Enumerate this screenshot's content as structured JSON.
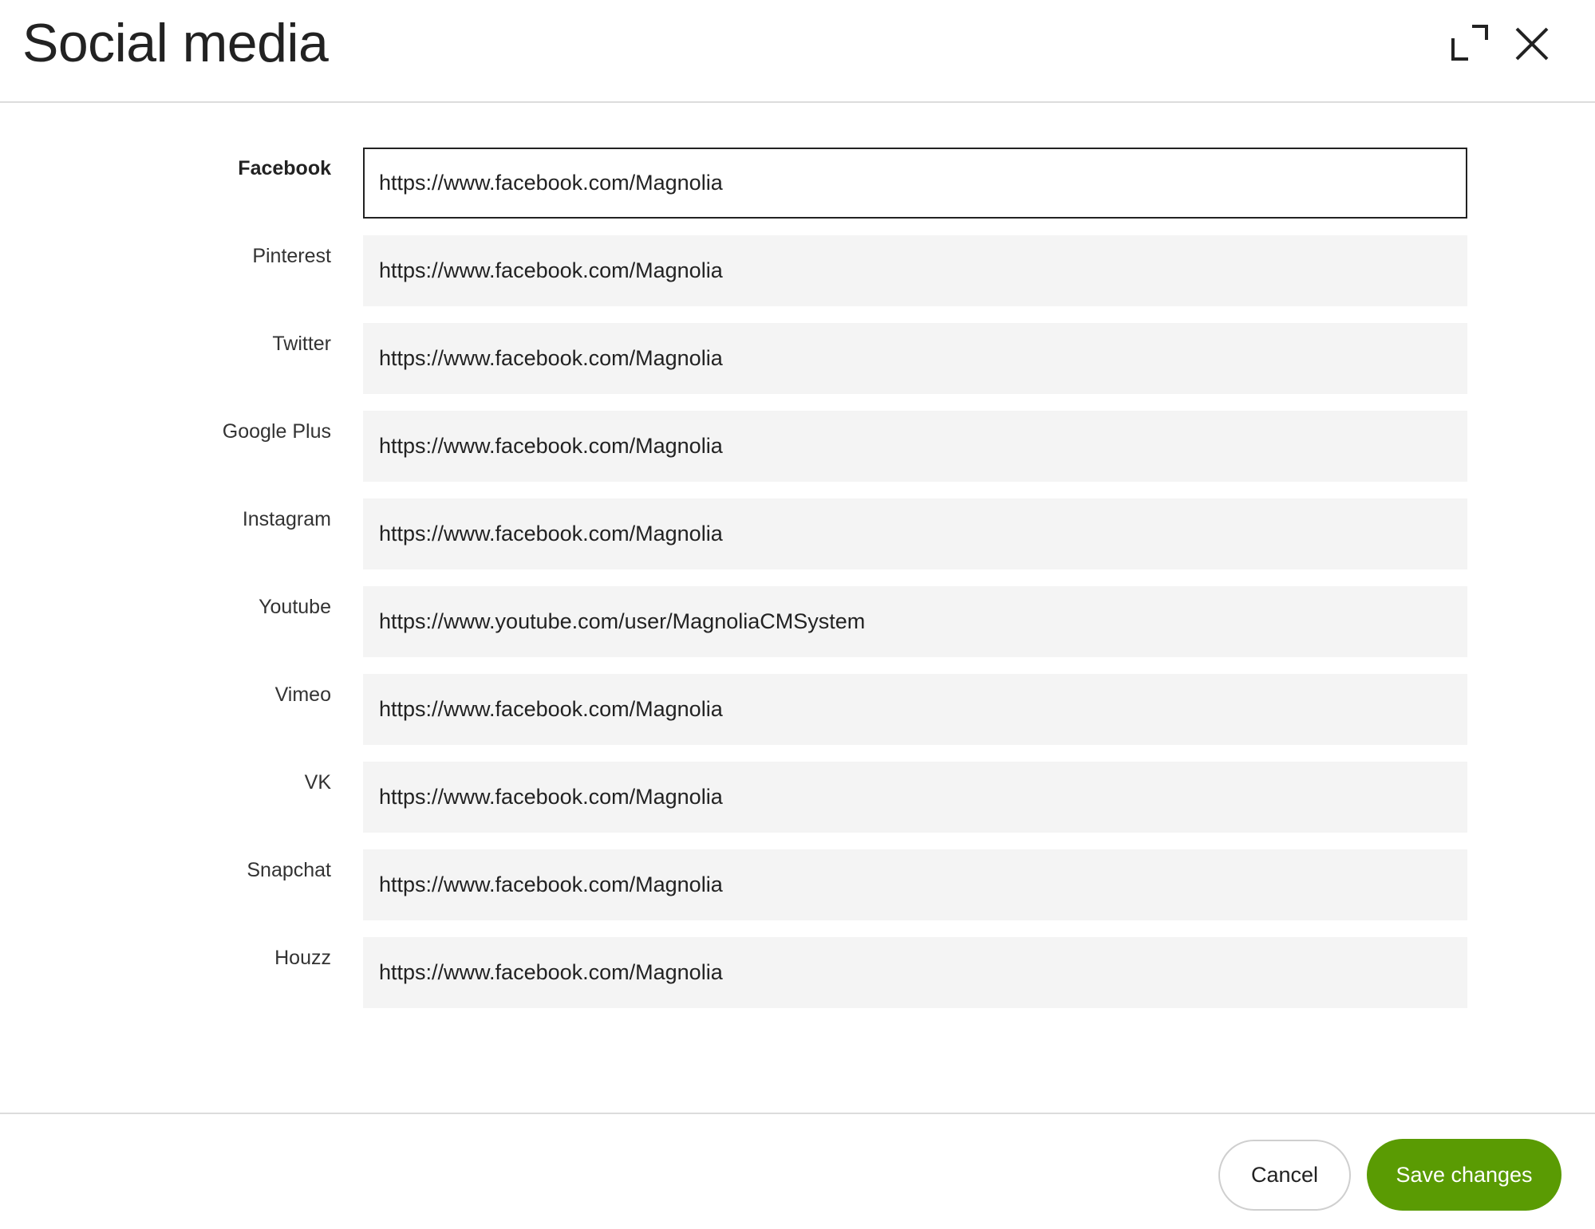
{
  "dialog": {
    "title": "Social media",
    "header_icons": {
      "maximize": "maximize-icon",
      "close": "close-icon"
    }
  },
  "fields": [
    {
      "label": "Facebook",
      "value": "https://www.facebook.com/Magnolia",
      "focused": true
    },
    {
      "label": "Pinterest",
      "value": "https://www.facebook.com/Magnolia",
      "focused": false
    },
    {
      "label": "Twitter",
      "value": "https://www.facebook.com/Magnolia",
      "focused": false
    },
    {
      "label": "Google Plus",
      "value": "https://www.facebook.com/Magnolia",
      "focused": false
    },
    {
      "label": "Instagram",
      "value": "https://www.facebook.com/Magnolia",
      "focused": false
    },
    {
      "label": "Youtube",
      "value": "https://www.youtube.com/user/MagnoliaCMSystem",
      "focused": false
    },
    {
      "label": "Vimeo",
      "value": "https://www.facebook.com/Magnolia",
      "focused": false
    },
    {
      "label": "VK",
      "value": "https://www.facebook.com/Magnolia",
      "focused": false
    },
    {
      "label": "Snapchat",
      "value": "https://www.facebook.com/Magnolia",
      "focused": false
    },
    {
      "label": "Houzz",
      "value": "https://www.facebook.com/Magnolia",
      "focused": false
    }
  ],
  "footer": {
    "cancel_label": "Cancel",
    "save_label": "Save changes"
  },
  "colors": {
    "primary": "#5a9b03",
    "field_bg": "#f4f4f4",
    "divider": "#dcdcdc"
  }
}
